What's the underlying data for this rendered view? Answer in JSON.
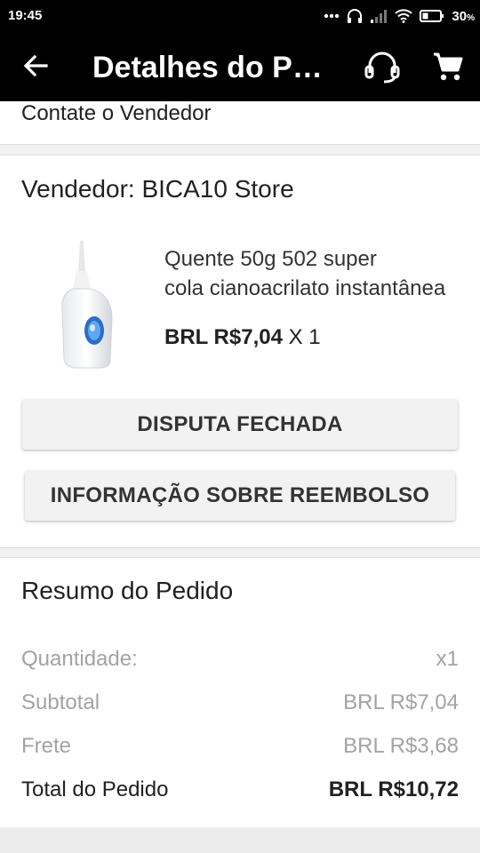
{
  "status": {
    "time": "19:45",
    "battery": "30"
  },
  "header": {
    "title": "Detalhes do Pedido"
  },
  "contact": {
    "label": "Contate o Vendedor"
  },
  "order": {
    "seller": "Vendedor: BICA10 Store",
    "product_title_line1": "Quente 50g 502 super",
    "product_title_line2": "cola cianoacrilato instantânea",
    "price": "BRL R$7,04",
    "qty": "X 1",
    "dispute_button": "DISPUTA FECHADA",
    "refund_button": "INFORMAÇÃO SOBRE REEMBOLSO"
  },
  "summary": {
    "title": "Resumo do Pedido",
    "rows": [
      {
        "label": "Quantidade:",
        "value": "x1"
      },
      {
        "label": "Subtotal",
        "value": "BRL R$7,04"
      },
      {
        "label": "Frete",
        "value": "BRL R$3,68"
      },
      {
        "label": "Total do Pedido",
        "value": "BRL R$10,72"
      }
    ]
  }
}
